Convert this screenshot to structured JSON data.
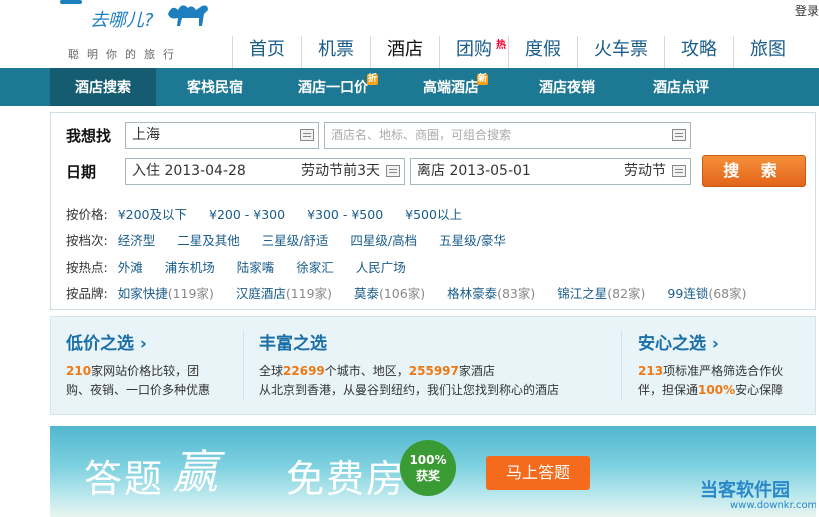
{
  "header": {
    "logo_text": "去哪儿?",
    "slogan": "聪明你的旅行",
    "login": "登录"
  },
  "nav": [
    "首页",
    "机票",
    "酒店",
    "团购",
    "度假",
    "火车票",
    "攻略",
    "旅图"
  ],
  "nav_hot": "热",
  "subnav": [
    {
      "label": "酒店搜索",
      "badge": ""
    },
    {
      "label": "客栈民宿",
      "badge": ""
    },
    {
      "label": "酒店一口价",
      "badge": "折"
    },
    {
      "label": "高端酒店",
      "badge": "新"
    },
    {
      "label": "酒店夜销",
      "badge": ""
    },
    {
      "label": "酒店点评",
      "badge": ""
    }
  ],
  "search": {
    "want_label": "我想找",
    "city_value": "上海",
    "keyword_placeholder": "酒店名、地标、商圈，可组合搜索",
    "date_label": "日期",
    "checkin_value": "入住 2013-04-28",
    "checkin_hint": "劳动节前3天",
    "checkout_value": "离店 2013-05-01",
    "checkout_hint": "劳动节",
    "search_button": "搜 索"
  },
  "filters": {
    "price": {
      "label": "按价格:",
      "items": [
        "¥200及以下",
        "¥200 - ¥300",
        "¥300 - ¥500",
        "¥500以上"
      ]
    },
    "grade": {
      "label": "按档次:",
      "items": [
        "经济型",
        "二星及其他",
        "三星级/舒适",
        "四星级/高档",
        "五星级/豪华"
      ]
    },
    "hotspot": {
      "label": "按热点:",
      "items": [
        "外滩",
        "浦东机场",
        "陆家嘴",
        "徐家汇",
        "人民广场"
      ]
    },
    "brand": {
      "label": "按品牌:",
      "items": [
        {
          "name": "如家快捷",
          "count": "(119家)"
        },
        {
          "name": "汉庭酒店",
          "count": "(119家)"
        },
        {
          "name": "莫泰",
          "count": "(106家)"
        },
        {
          "name": "格林豪泰",
          "count": "(83家)"
        },
        {
          "name": "锦江之星",
          "count": "(82家)"
        },
        {
          "name": "99连锁",
          "count": "(68家)"
        }
      ]
    }
  },
  "promo": {
    "low": {
      "title": "低价之选",
      "num": "210",
      "line1": "家网站价格比较，团",
      "line2": "购、夜销、一口价多种优惠"
    },
    "rich": {
      "title": "丰富之选",
      "pre": "全球",
      "num1": "22699",
      "mid": "个城市、地区，",
      "num2": "255997",
      "post": "家酒店",
      "line2": "从北京到香港，从曼谷到纽约，我们让您找到称心的酒店"
    },
    "safe": {
      "title": "安心之选",
      "num1": "213",
      "line1": "项标准严格筛选合作伙",
      "pre2": "伴，担保通",
      "num2": "100%",
      "post2": "安心保障"
    }
  },
  "banner": {
    "text1": "答题",
    "text_win": "赢",
    "text2": "免费房",
    "badge_line1": "100%",
    "badge_line2": "获奖",
    "button": "马上答题",
    "watermark": "当客软件园",
    "watermark_url": "www.downkr.com"
  }
}
